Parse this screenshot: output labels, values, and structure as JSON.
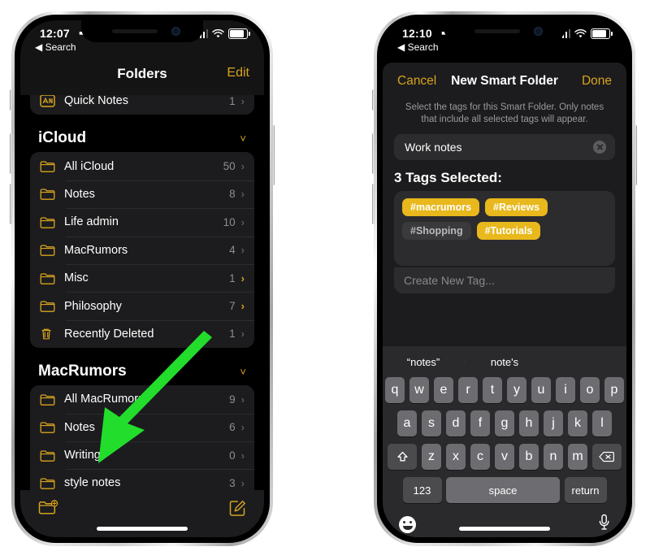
{
  "left_phone": {
    "status": {
      "time": "12:07",
      "location_icon": "location-arrow-icon",
      "back_label": "◀ Search"
    },
    "nav": {
      "title": "Folders",
      "edit_label": "Edit"
    },
    "partial_row": {
      "name": "Quick Notes",
      "count": "1",
      "icon": "quick-note-icon"
    },
    "sections": [
      {
        "title": "iCloud",
        "collapse_icon": "chevron-down-icon",
        "rows": [
          {
            "name": "All iCloud",
            "count": "50",
            "icon": "folder-icon",
            "chevron": "gray"
          },
          {
            "name": "Notes",
            "count": "8",
            "icon": "folder-icon",
            "chevron": "gray"
          },
          {
            "name": "Life admin",
            "count": "10",
            "icon": "folder-icon",
            "chevron": "gray"
          },
          {
            "name": "MacRumors",
            "count": "4",
            "icon": "folder-icon",
            "chevron": "gray"
          },
          {
            "name": "Misc",
            "count": "1",
            "icon": "folder-icon",
            "chevron": "gold"
          },
          {
            "name": "Philosophy",
            "count": "7",
            "icon": "folder-icon",
            "chevron": "gold"
          },
          {
            "name": "Recently Deleted",
            "count": "1",
            "icon": "trash-icon",
            "chevron": "gray"
          }
        ]
      },
      {
        "title": "MacRumors",
        "collapse_icon": "chevron-down-icon",
        "rows": [
          {
            "name": "All MacRumors",
            "count": "9",
            "icon": "folder-icon",
            "chevron": "gray"
          },
          {
            "name": "Notes",
            "count": "6",
            "icon": "folder-icon",
            "chevron": "gray"
          },
          {
            "name": "Writing",
            "count": "0",
            "icon": "folder-icon",
            "chevron": "gray"
          },
          {
            "name": "style notes",
            "count": "3",
            "icon": "folder-icon",
            "chevron": "gray"
          }
        ]
      }
    ],
    "toolbar": {
      "new_folder_icon": "new-folder-icon",
      "compose_icon": "compose-icon"
    },
    "annotation": {
      "type": "arrow",
      "color": "#22dd2b",
      "points_to": "new-folder-button"
    }
  },
  "right_phone": {
    "status": {
      "time": "12:10",
      "location_icon": "location-arrow-icon",
      "back_label": "◀ Search"
    },
    "sheet": {
      "cancel_label": "Cancel",
      "title": "New Smart Folder",
      "done_label": "Done",
      "description": "Select the tags for this Smart Folder. Only notes that include all selected tags will appear.",
      "name_value": "Work notes",
      "clear_icon": "clear-text-icon",
      "tags_header": "3 Tags Selected:",
      "tags": [
        {
          "label": "#macrumors",
          "selected": true
        },
        {
          "label": "#Reviews",
          "selected": true
        },
        {
          "label": "#Shopping",
          "selected": false
        },
        {
          "label": "#Tutorials",
          "selected": true
        }
      ],
      "create_new_tag_placeholder": "Create New Tag..."
    },
    "keyboard": {
      "predictions": [
        "“notes”",
        "note's",
        ""
      ],
      "row1": [
        "q",
        "w",
        "e",
        "r",
        "t",
        "y",
        "u",
        "i",
        "o",
        "p"
      ],
      "row2": [
        "a",
        "s",
        "d",
        "f",
        "g",
        "h",
        "j",
        "k",
        "l"
      ],
      "row3": [
        "z",
        "x",
        "c",
        "v",
        "b",
        "n",
        "m"
      ],
      "shift_icon": "shift-icon",
      "backspace_icon": "backspace-icon",
      "numbers_label": "123",
      "space_label": "space",
      "return_label": "return",
      "emoji_icon": "emoji-icon",
      "mic_icon": "microphone-icon"
    }
  },
  "colors": {
    "accent": "#d8a41e",
    "tag_selected": "#e8b81c",
    "arrow": "#22dd2b",
    "sheet_bg": "#1c1c1e"
  }
}
